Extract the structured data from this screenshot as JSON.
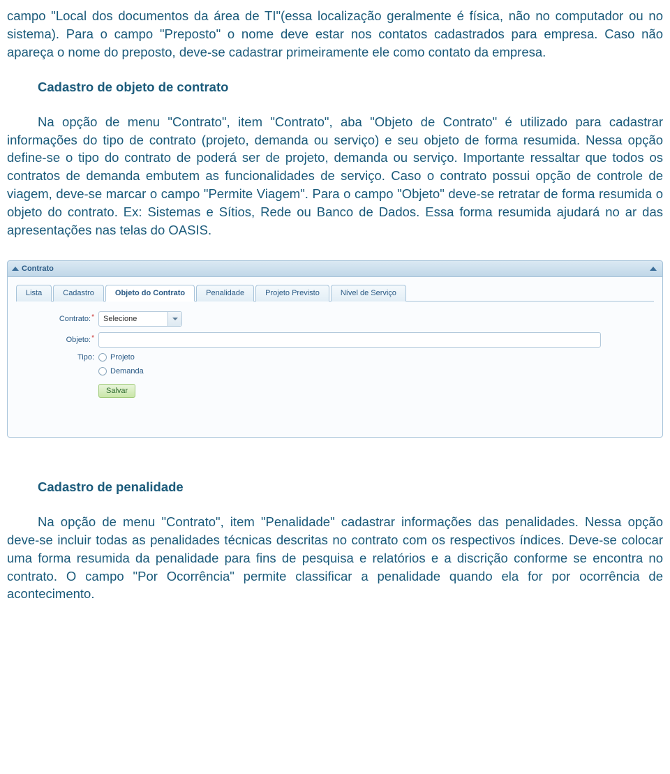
{
  "paragraphs": {
    "p1": "campo \"Local dos documentos da área de TI\"(essa localização geralmente é física, não no computador ou no sistema). Para o campo \"Preposto\" o nome deve estar nos contatos cadastrados para empresa. Caso não apareça o nome do preposto, deve-se cadastrar primeiramente ele como contato da empresa.",
    "p2": "Na opção de menu \"Contrato\", item \"Contrato\", aba \"Objeto de Contrato\" é utilizado para cadastrar informações do tipo de contrato (projeto, demanda ou serviço) e seu objeto de forma resumida. Nessa opção define-se o tipo do contrato de poderá ser de projeto, demanda ou serviço. Importante ressaltar que todos os contratos de demanda embutem as funcionalidades de serviço. Caso o contrato possui opção de controle de viagem, deve-se marcar o campo \"Permite Viagem\". Para o campo \"Objeto\" deve-se retratar de forma resumida o objeto do contrato. Ex: Sistemas e Sítios, Rede ou Banco de Dados. Essa forma resumida ajudará no ar das apresentações nas telas do OASIS.",
    "p3": "Na opção de menu \"Contrato\", item \"Penalidade\" cadastrar informações das penalidades. Nessa opção deve-se incluir todas as penalidades técnicas descritas no contrato com os respectivos índices. Deve-se colocar uma forma resumida da penalidade para fins de pesquisa e relatórios e a discrição conforme se encontra no contrato. O campo \"Por Ocorrência\" permite classificar a penalidade quando ela for por ocorrência de acontecimento."
  },
  "headings": {
    "h1": "Cadastro de objeto de contrato",
    "h2": "Cadastro de penalidade"
  },
  "panel": {
    "title": "Contrato",
    "tabs": {
      "t0": "Lista",
      "t1": "Cadastro",
      "t2": "Objeto do Contrato",
      "t3": "Penalidade",
      "t4": "Projeto Previsto",
      "t5": "Nível de Serviço"
    },
    "form": {
      "contrato_label": "Contrato:",
      "contrato_value": "Selecione",
      "objeto_label": "Objeto:",
      "objeto_value": "",
      "tipo_label": "Tipo:",
      "radio_projeto": "Projeto",
      "radio_demanda": "Demanda",
      "save_label": "Salvar"
    }
  }
}
